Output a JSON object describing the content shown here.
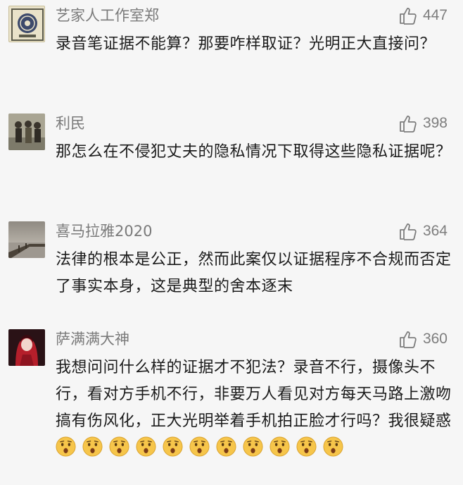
{
  "comments": [
    {
      "username": "艺家人工作室郑",
      "likes": "447",
      "text": "录音笔证据不能算？那要咋样取证？光明正大直接问？",
      "avatar_icon": "emblem-avatar-icon"
    },
    {
      "username": "利民",
      "likes": "398",
      "text": "那怎么在不侵犯丈夫的隐私情况下取得这些隐私证据呢？",
      "avatar_icon": "people-photo-avatar-icon"
    },
    {
      "username": "喜马拉雅2020",
      "likes": "364",
      "text": "法律的根本是公正，然而此案仅以证据程序不合规而否定了事实本身，这是典型的舍本逐末",
      "avatar_icon": "lake-pier-avatar-icon"
    },
    {
      "username": "萨满满大神",
      "likes": "360",
      "text": "我想问问什么样的证据才不犯法？录音不行，摄像头不行，看对方手机不行，非要万人看见对方每天马路上激吻搞有伤风化，正大光明举着手机拍正脸才行吗？我很疑惑",
      "avatar_icon": "anime-girl-avatar-icon",
      "emoji_count": 11,
      "emoji_icon": "surprised-face-emoji-icon"
    }
  ],
  "colors": {
    "background": "#f6f6f6",
    "username": "#7a7a7a",
    "likes": "#7d7d7d",
    "text": "#1b1b1b",
    "emoji": "#f6c54a"
  }
}
